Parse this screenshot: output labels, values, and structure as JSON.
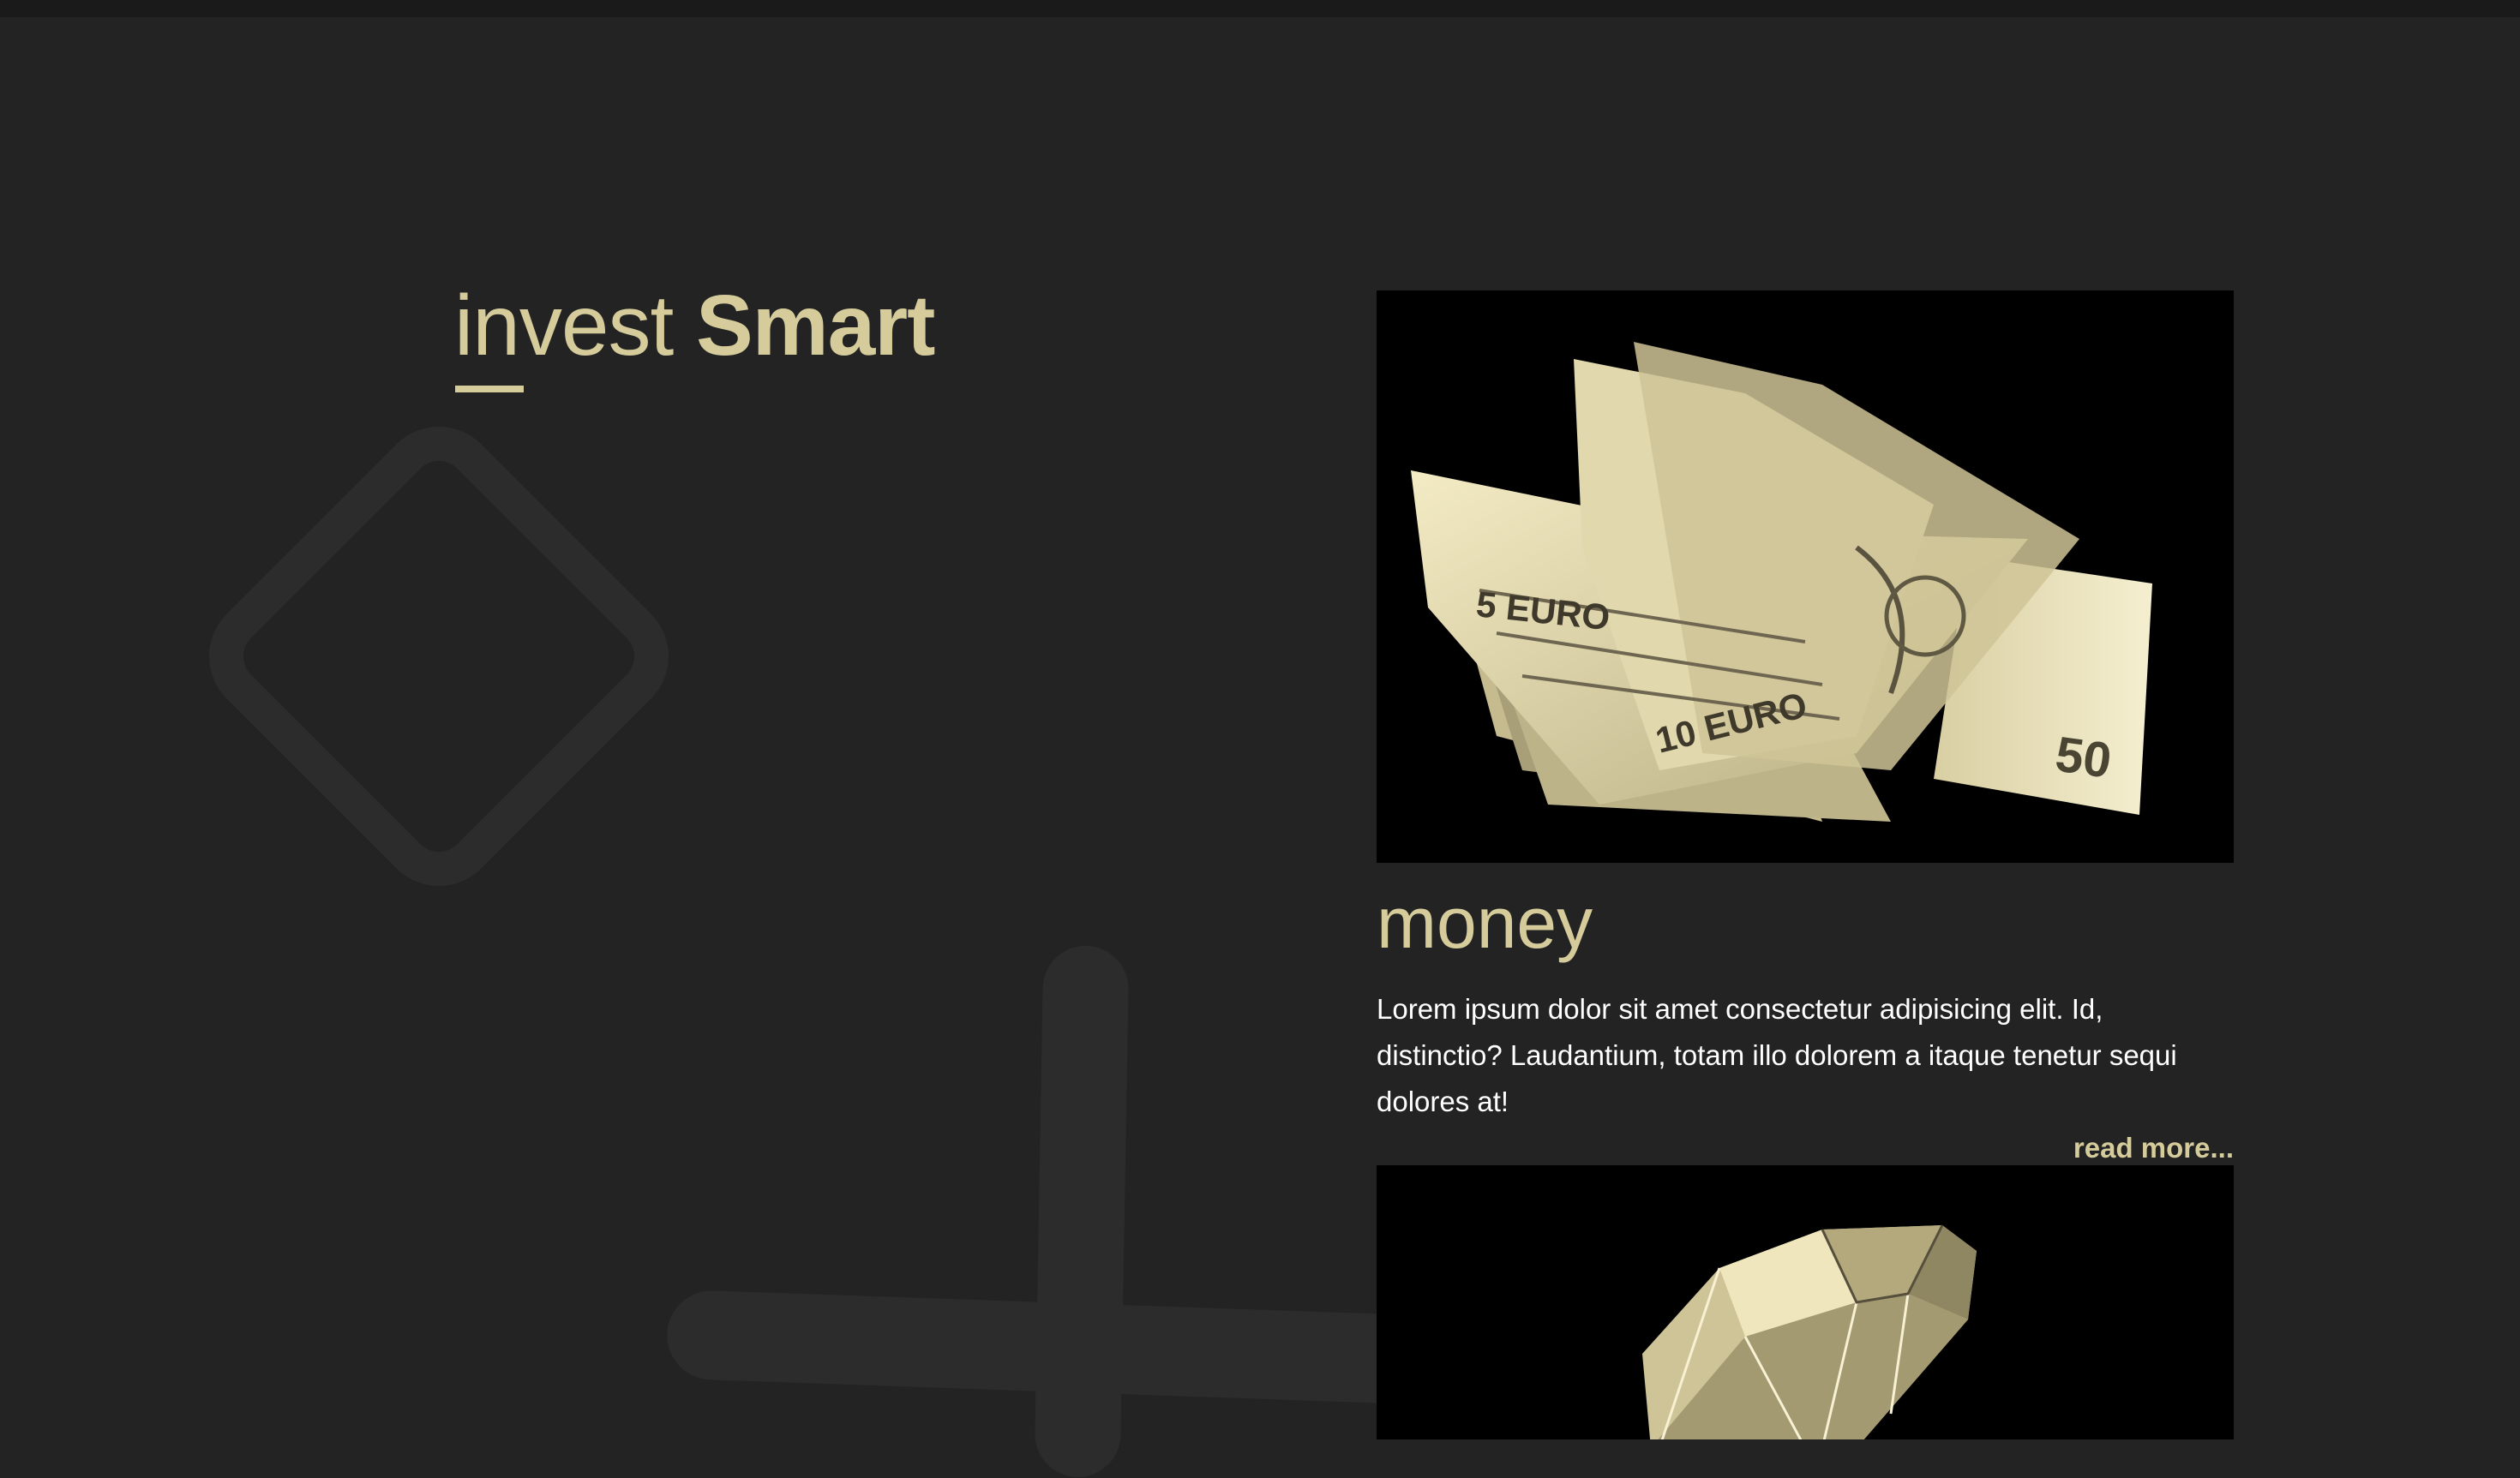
{
  "brand": {
    "part1": "invest",
    "part2": "Smart"
  },
  "cards": [
    {
      "title": "money",
      "text": "Lorem ipsum dolor sit amet consectetur adipisicing elit. Id, distinctio? Laudantium, totam illo dolorem a itaque tenetur sequi dolores at!",
      "more": "read more...",
      "image": "euro-banknotes-image"
    },
    {
      "image": "diamond-image"
    }
  ],
  "colors": {
    "background": "#232323",
    "accent": "#d6cc9b",
    "text": "#ffffff",
    "decoration": "#2c2c2c"
  }
}
